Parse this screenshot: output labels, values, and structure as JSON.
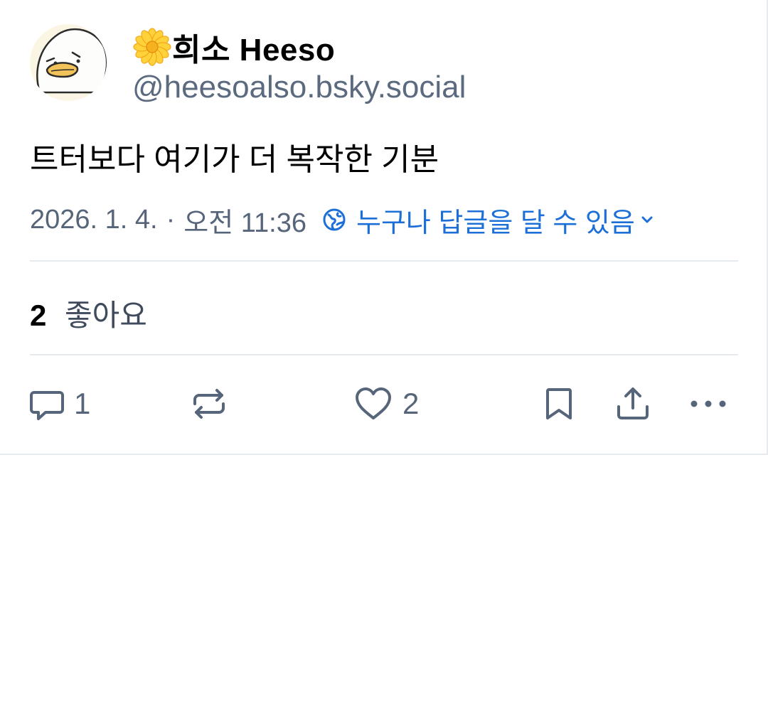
{
  "author": {
    "display_name": "희소 Heeso",
    "name_emoji_icon": "flower-emoji-icon",
    "handle": "@heesoalso.bsky.social",
    "avatar_icon": "duck-avatar-icon"
  },
  "post": {
    "text": "트터보다 여기가 더 복작한 기분",
    "date": "2026. 1. 4.",
    "separator": "·",
    "time": "오전 11:36",
    "reply_setting": {
      "icon": "globe-icon",
      "label": "누구나 답글을 달 수 있음",
      "chevron_icon": "chevron-down-icon"
    }
  },
  "likes_summary": {
    "count": "2",
    "label": "좋아요"
  },
  "actions": {
    "reply": {
      "icon": "reply-icon",
      "count": "1"
    },
    "repost": {
      "icon": "repost-icon"
    },
    "like": {
      "icon": "heart-icon",
      "count": "2"
    },
    "bookmark": {
      "icon": "bookmark-icon"
    },
    "share": {
      "icon": "share-icon"
    },
    "more": {
      "icon": "more-icon"
    }
  },
  "colors": {
    "accent_blue": "#1d6fd8",
    "muted_text": "#56657a",
    "divider": "#e6e9ee"
  }
}
